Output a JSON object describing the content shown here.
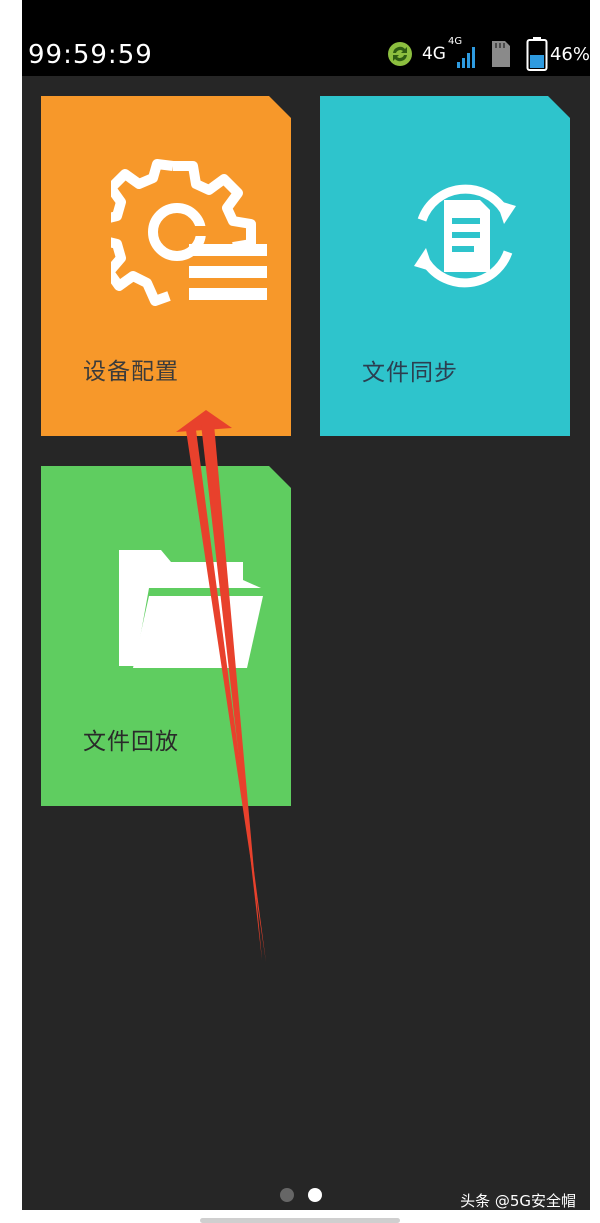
{
  "status_bar": {
    "time": "99:59:59",
    "network": "4G",
    "network_small": "4G",
    "battery": "46%"
  },
  "tiles": [
    {
      "id": "device-config",
      "label": "设备配置",
      "color": "#f7982a",
      "icon": "gear-list-icon"
    },
    {
      "id": "file-sync",
      "label": "文件同步",
      "color": "#2ec4cc",
      "icon": "document-sync-icon"
    },
    {
      "id": "file-playback",
      "label": "文件回放",
      "color": "#5fcd60",
      "icon": "folder-icon"
    }
  ],
  "pager": {
    "count": 2,
    "active": 2
  },
  "watermark": "头条 @5G安全帽",
  "colors": {
    "background": "#262626",
    "status_bar": "#000000",
    "annotation_arrow": "#e8412c"
  }
}
